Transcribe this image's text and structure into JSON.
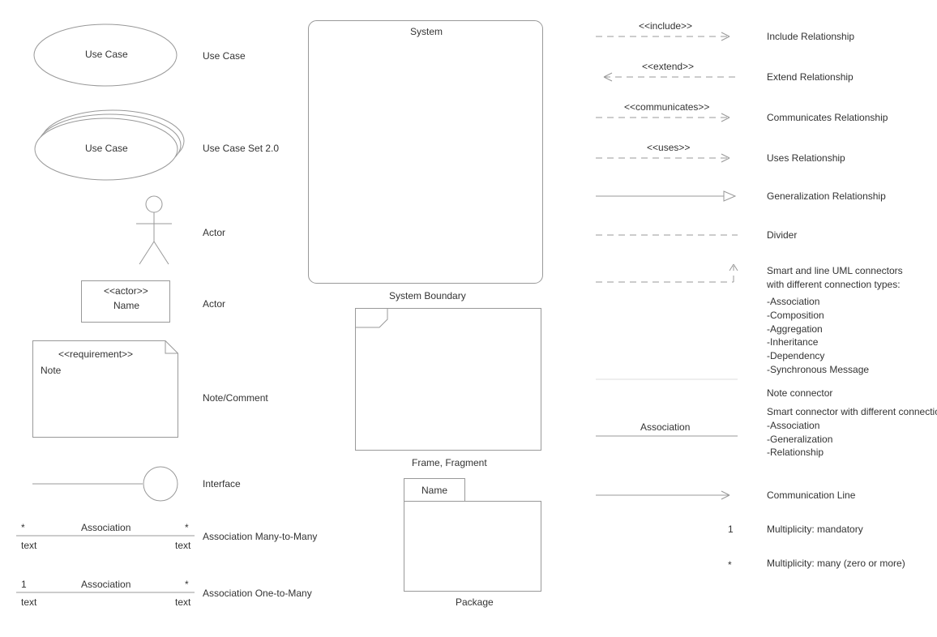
{
  "col1": {
    "usecase": {
      "text": "Use Case",
      "label": "Use Case"
    },
    "usecaseSet": {
      "text": "Use Case",
      "label": "Use Case Set 2.0"
    },
    "actorStick": {
      "label": "Actor"
    },
    "actorBox": {
      "stereo": "<<actor>>",
      "name": "Name",
      "label": "Actor"
    },
    "note": {
      "stereo": "<<requirement>>",
      "text": "Note",
      "label": "Note/Comment"
    },
    "interface": {
      "label": "Interface"
    },
    "assocMM": {
      "top": "Association",
      "leftM": "*",
      "rightM": "*",
      "leftT": "text",
      "rightT": "text",
      "label": "Association Many-to-Many"
    },
    "assocOM": {
      "top": "Association",
      "leftM": "1",
      "rightM": "*",
      "leftT": "text",
      "rightT": "text",
      "label": "Association One-to-Many"
    }
  },
  "col2": {
    "system": {
      "title": "System",
      "label": "System Boundary"
    },
    "frame": {
      "label": "Frame, Fragment"
    },
    "package": {
      "name": "Name",
      "label": "Package"
    }
  },
  "col3": {
    "include": {
      "tag": "<<include>>",
      "label": "Include Relationship"
    },
    "extend": {
      "tag": "<<extend>>",
      "label": "Extend Relationship"
    },
    "communicates": {
      "tag": "<<communicates>>",
      "label": "Communicates Relationship"
    },
    "uses": {
      "tag": "<<uses>>",
      "label": "Uses Relationship"
    },
    "generalization": {
      "label": "Generalization Relationship"
    },
    "divider": {
      "label": "Divider"
    },
    "smart": {
      "label": "Smart and line UML connectors with different connection types:",
      "items": "-Association\n-Composition\n-Aggregation\n-Inheritance\n-Dependency\n-Synchronous Message"
    },
    "noteconn": {
      "label": "Note connector"
    },
    "assoc": {
      "text": "Association",
      "label": "Smart connector with different connection types:\n-Association\n-Generalization\n-Relationship"
    },
    "comm": {
      "label": "Communication Line"
    },
    "mult1": {
      "sym": "1",
      "label": "Multiplicity: mandatory"
    },
    "multMany": {
      "sym": "*",
      "label": "Multiplicity: many (zero or more)"
    }
  }
}
